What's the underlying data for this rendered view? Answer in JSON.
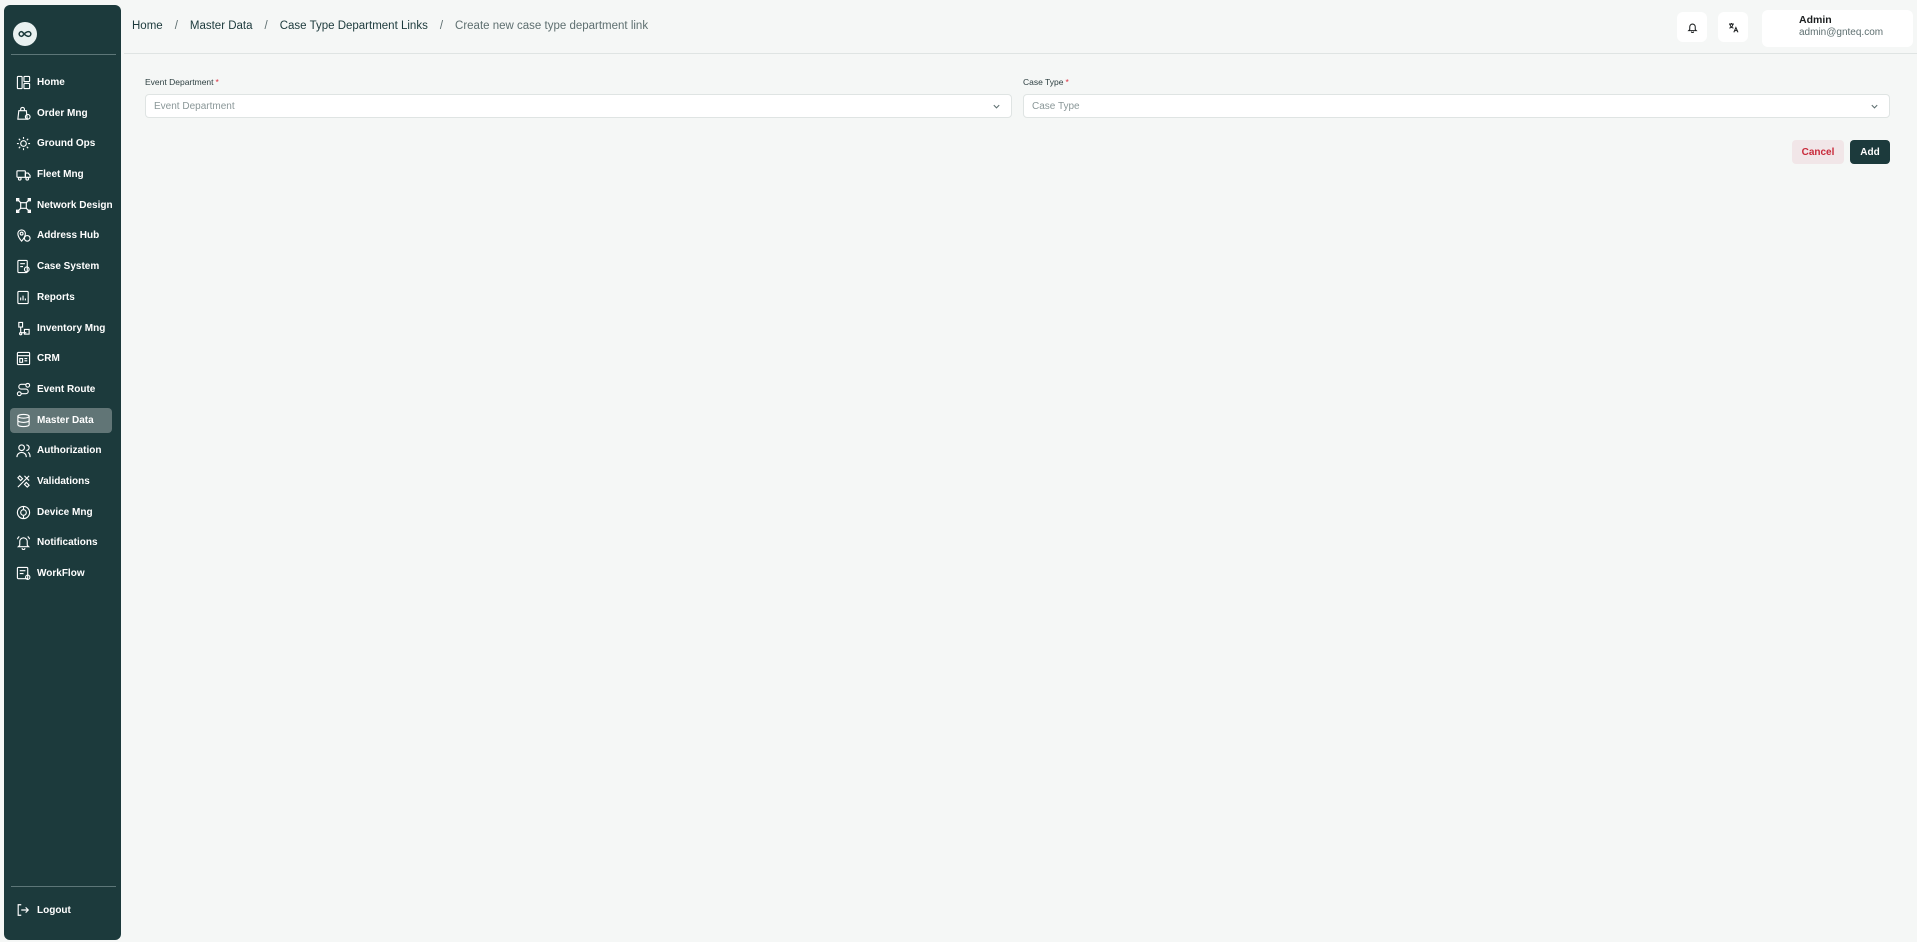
{
  "sidebar": {
    "items": [
      {
        "label": "Home",
        "icon": "home-icon"
      },
      {
        "label": "Order Mng",
        "icon": "order-icon"
      },
      {
        "label": "Ground Ops",
        "icon": "ground-ops-icon"
      },
      {
        "label": "Fleet Mng",
        "icon": "truck-icon"
      },
      {
        "label": "Network Design",
        "icon": "network-icon"
      },
      {
        "label": "Address Hub",
        "icon": "address-icon"
      },
      {
        "label": "Case System",
        "icon": "case-icon"
      },
      {
        "label": "Reports",
        "icon": "report-icon"
      },
      {
        "label": "Inventory Mng",
        "icon": "inventory-icon"
      },
      {
        "label": "CRM",
        "icon": "crm-icon"
      },
      {
        "label": "Event Route",
        "icon": "route-icon"
      },
      {
        "label": "Master Data",
        "icon": "database-icon",
        "active": true
      },
      {
        "label": "Authorization",
        "icon": "users-icon"
      },
      {
        "label": "Validations",
        "icon": "validation-icon"
      },
      {
        "label": "Device Mng",
        "icon": "device-icon"
      },
      {
        "label": "Notifications",
        "icon": "bell-icon"
      },
      {
        "label": "WorkFlow",
        "icon": "workflow-icon"
      }
    ],
    "logout_label": "Logout"
  },
  "breadcrumb": {
    "home": "Home",
    "master_data": "Master Data",
    "links": "Case Type Department Links",
    "current": "Create new case type department link"
  },
  "profile": {
    "name": "Admin",
    "email": "admin@gnteq.com"
  },
  "form": {
    "event_department": {
      "label": "Event Department",
      "required_mark": "*",
      "placeholder": "Event Department"
    },
    "case_type": {
      "label": "Case Type",
      "required_mark": "*",
      "placeholder": "Case Type"
    }
  },
  "actions": {
    "cancel_label": "Cancel",
    "add_label": "Add"
  },
  "colors": {
    "sidebar_bg": "#1c3a3c",
    "active_item_bg": "#617576",
    "cancel_text": "#c8293a",
    "add_bg": "#1c3a3c"
  }
}
